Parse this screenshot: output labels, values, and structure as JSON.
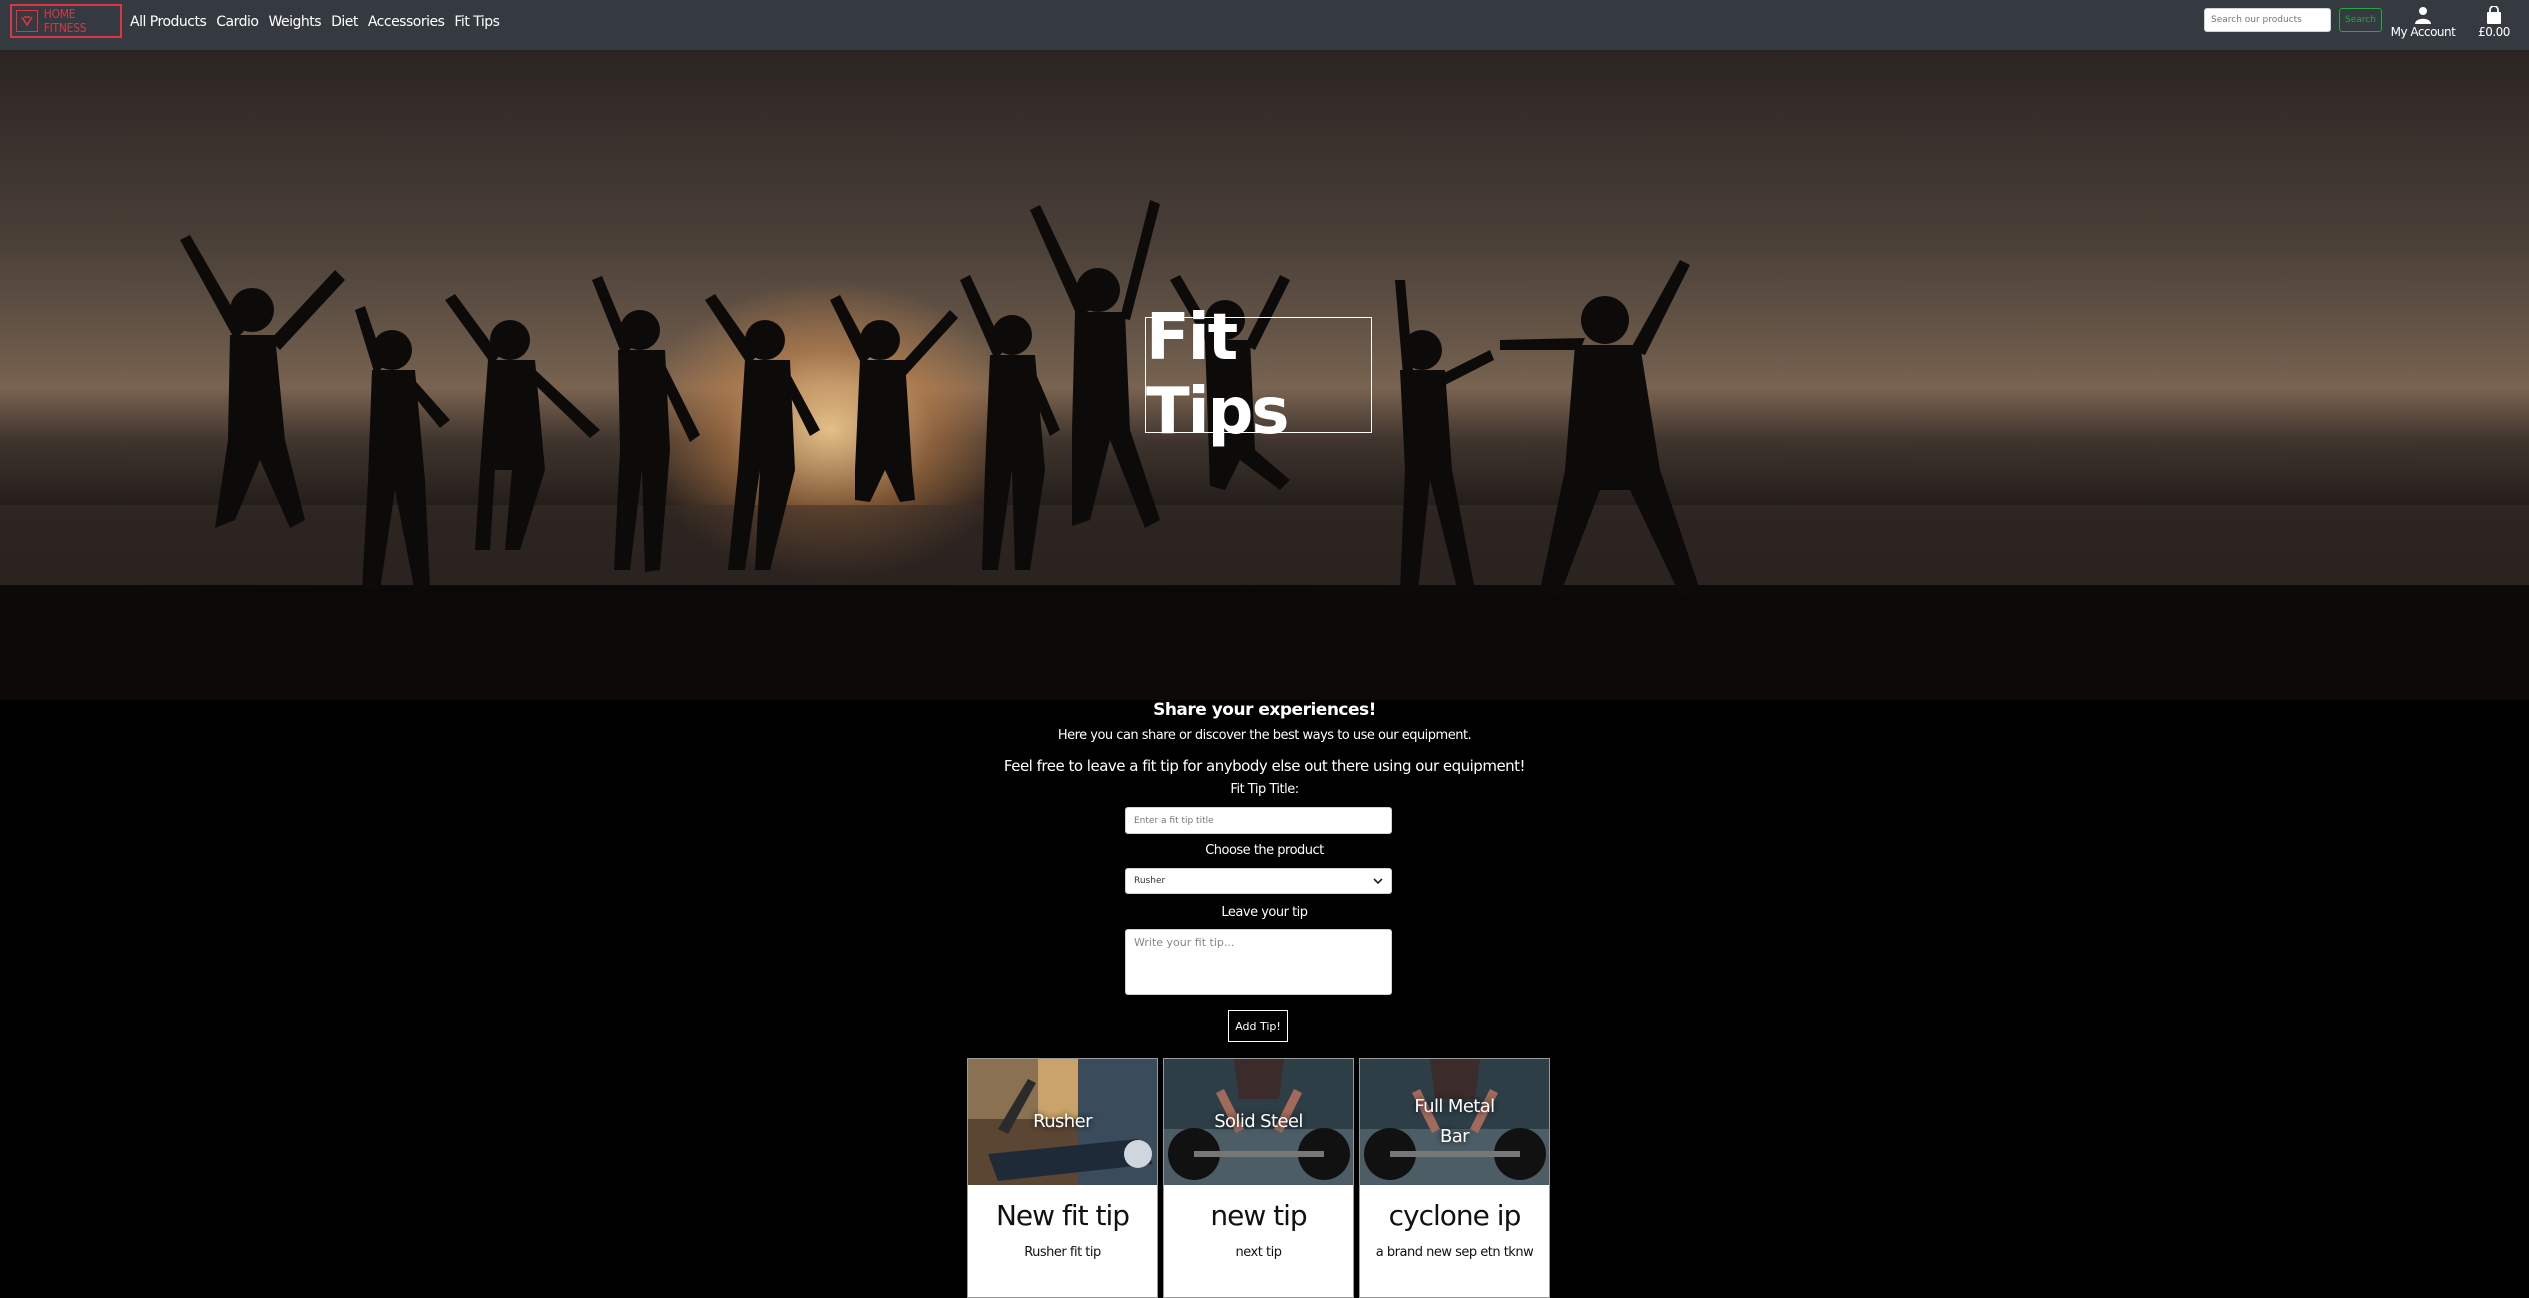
{
  "nav": {
    "brand": "HOME FITNESS",
    "links": [
      "All Products",
      "Cardio",
      "Weights",
      "Diet",
      "Accessories",
      "Fit Tips"
    ],
    "search_placeholder": "Search our products",
    "search_button": "Search",
    "account_label": "My Account",
    "bag_total": "£0.00",
    "accent_color": "#dc3545",
    "search_color": "#28a745"
  },
  "hero": {
    "title": "Fit Tips"
  },
  "form": {
    "heading": "Share your experiences!",
    "intro": "Here you can share or discover the best ways to use our equipment.",
    "invite": "Feel free to leave a fit tip for anybody else out there using our equipment!",
    "title_label": "Fit Tip Title:",
    "title_placeholder": "Enter a fit tip title",
    "product_label": "Choose the product",
    "product_selected": "Rusher",
    "tip_label": "Leave your tip",
    "tip_placeholder": "Write your fit tip...",
    "submit_label": "Add Tip!"
  },
  "cards": [
    {
      "product": "Rusher",
      "title": "New fit tip",
      "subtitle": "Rusher fit tip",
      "image": "treadmill"
    },
    {
      "product": "Solid Steel",
      "title": "new tip",
      "subtitle": "next tip",
      "image": "barbell"
    },
    {
      "product": "Full Metal Bar",
      "title": "cyclone ip",
      "subtitle": "a brand new sep etn tknw",
      "image": "barbell"
    }
  ]
}
